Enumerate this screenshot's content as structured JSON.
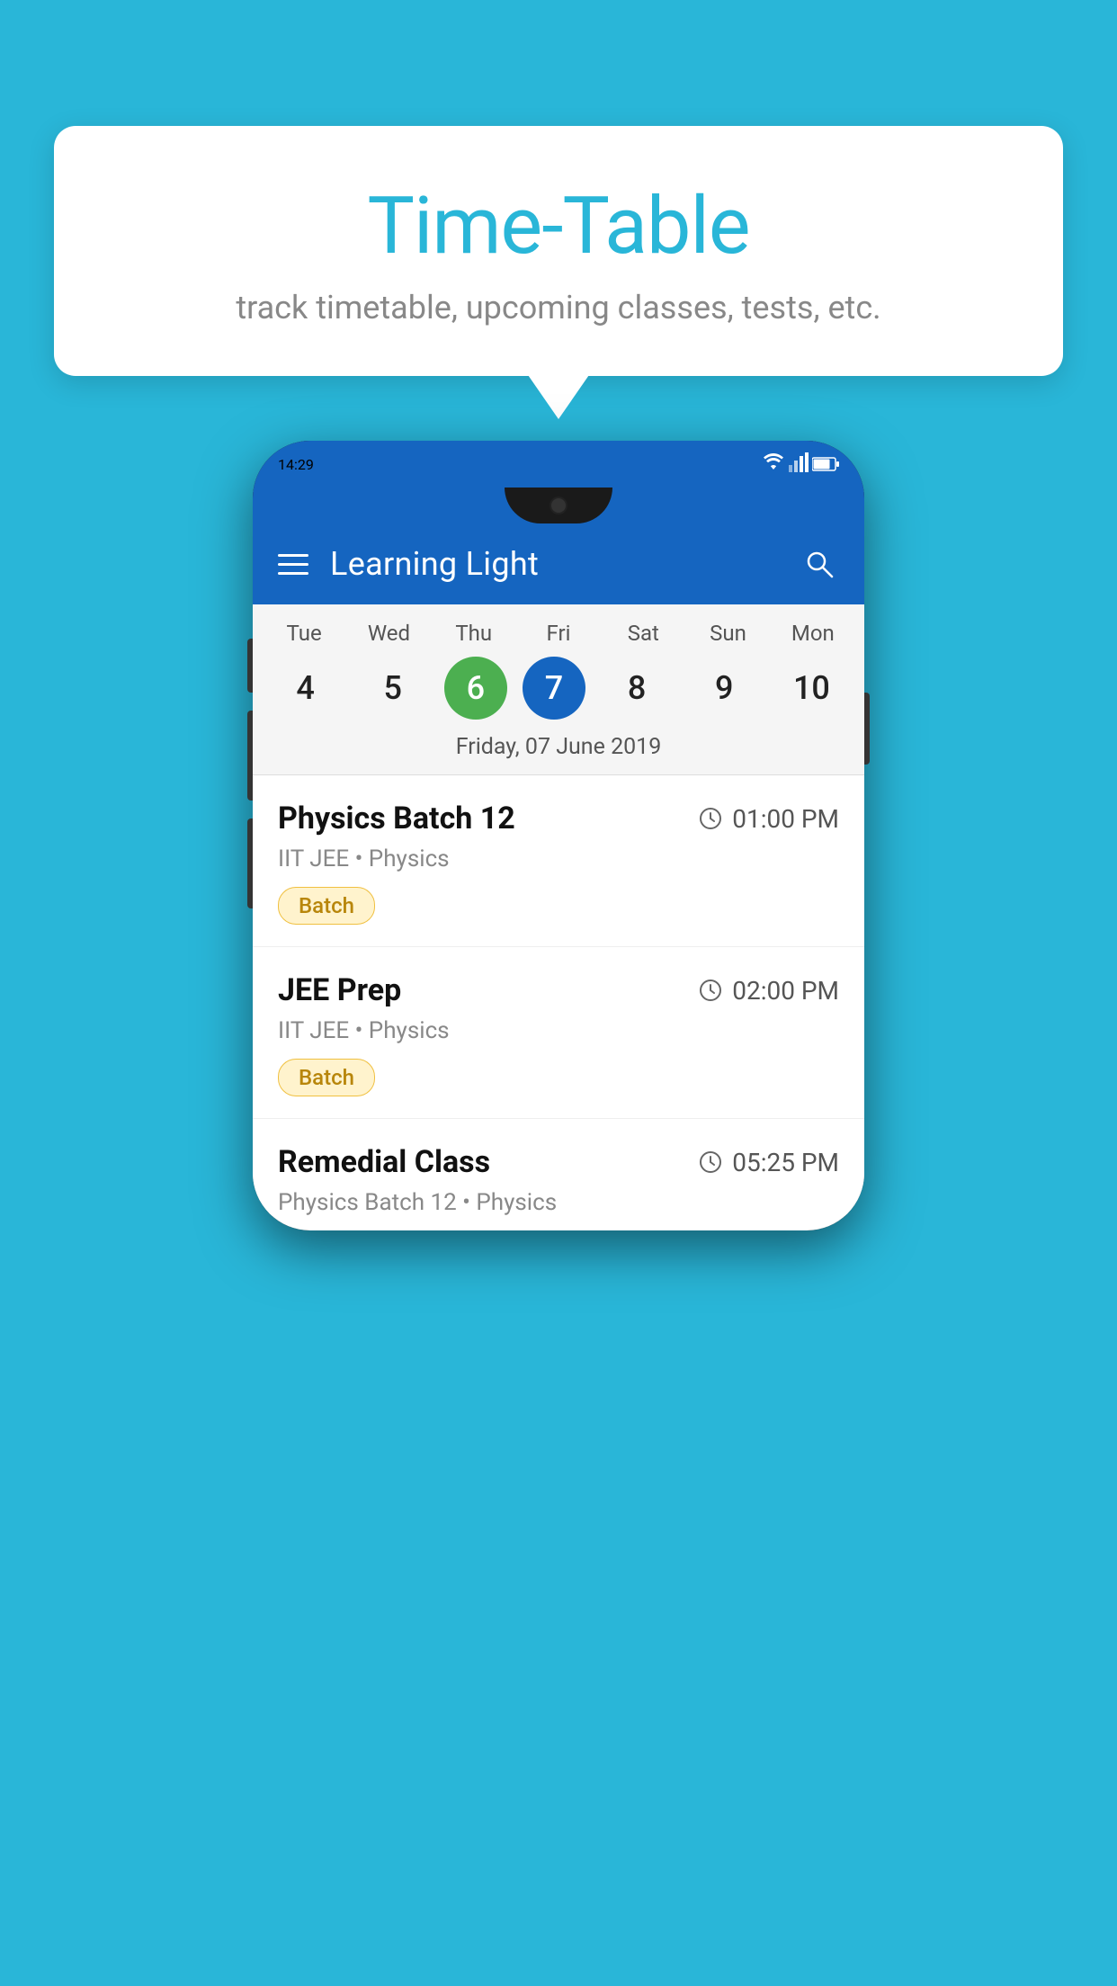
{
  "background_color": "#29B6D8",
  "speech_bubble": {
    "title": "Time-Table",
    "subtitle": "track timetable, upcoming classes, tests, etc."
  },
  "phone": {
    "status_bar": {
      "time": "14:29",
      "signal_icons": [
        "wifi",
        "signal",
        "battery"
      ]
    },
    "app_bar": {
      "title": "Learning Light",
      "search_icon": "🔍"
    },
    "calendar": {
      "days": [
        {
          "label": "Tue",
          "number": "4"
        },
        {
          "label": "Wed",
          "number": "5"
        },
        {
          "label": "Thu",
          "number": "6",
          "state": "today"
        },
        {
          "label": "Fri",
          "number": "7",
          "state": "selected"
        },
        {
          "label": "Sat",
          "number": "8"
        },
        {
          "label": "Sun",
          "number": "9"
        },
        {
          "label": "Mon",
          "number": "10"
        }
      ],
      "selected_date": "Friday, 07 June 2019"
    },
    "schedule": [
      {
        "name": "Physics Batch 12",
        "time": "01:00 PM",
        "meta": "IIT JEE • Physics",
        "tag": "Batch"
      },
      {
        "name": "JEE Prep",
        "time": "02:00 PM",
        "meta": "IIT JEE • Physics",
        "tag": "Batch"
      },
      {
        "name": "Remedial Class",
        "time": "05:25 PM",
        "meta": "Physics Batch 12 • Physics",
        "tag": null
      }
    ]
  }
}
